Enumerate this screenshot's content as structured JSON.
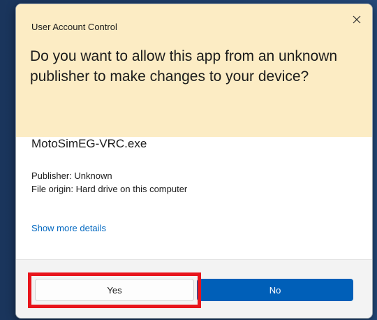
{
  "dialog": {
    "title": "User Account Control",
    "question": "Do you want to allow this app from an unknown publisher to make changes to your device?",
    "app_name": "MotoSimEG-VRC.exe",
    "publisher": "Publisher: Unknown",
    "file_origin": "File origin: Hard drive on this computer",
    "show_more": "Show more details",
    "yes_label": "Yes",
    "no_label": "No",
    "close_icon": "close-icon"
  },
  "colors": {
    "header_bg": "#fcecc4",
    "primary_button": "#005fb8",
    "link": "#0067c0",
    "highlight": "#e8141b"
  }
}
